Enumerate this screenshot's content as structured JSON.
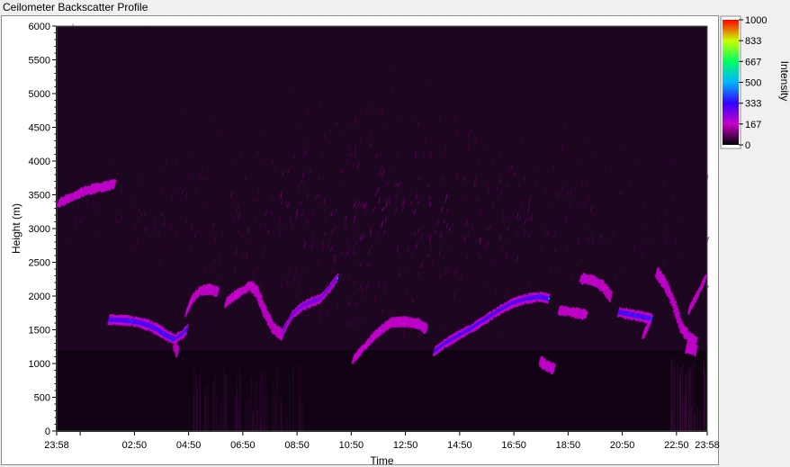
{
  "window": {
    "title": "Ceilometer Backscatter Profile"
  },
  "chart_data": {
    "type": "heatmap",
    "title": "",
    "xlabel": "Time",
    "ylabel": "Height (m)",
    "x_tick_labels": [
      "23:58",
      "02:50",
      "04:50",
      "06:50",
      "08:50",
      "10:50",
      "12:50",
      "14:50",
      "16:50",
      "18:50",
      "20:50",
      "22:50",
      "23:58"
    ],
    "x_tick_hours": [
      -0.0333,
      2.8333,
      4.8333,
      6.8333,
      8.8333,
      10.8333,
      12.8333,
      14.8333,
      16.8333,
      18.8333,
      20.8333,
      22.8333,
      23.9667
    ],
    "x_minor_tick_hours": [
      0.8333
    ],
    "xlim_hours": [
      -0.0333,
      23.9667
    ],
    "ylim": [
      0,
      6000
    ],
    "y_ticks": [
      0,
      500,
      1000,
      1500,
      2000,
      2500,
      3000,
      3500,
      4000,
      4500,
      5000,
      5500,
      6000
    ],
    "colorbar": {
      "label": "Intensity",
      "range": [
        0,
        1000
      ],
      "ticks": [
        1000,
        833,
        667,
        500,
        333,
        167,
        0
      ],
      "stops": [
        {
          "value": 0,
          "color": "#000000"
        },
        {
          "value": 167,
          "color": "#c800c8"
        },
        {
          "value": 333,
          "color": "#3200ff"
        },
        {
          "value": 500,
          "color": "#00b4ff"
        },
        {
          "value": 667,
          "color": "#00ff64"
        },
        {
          "value": 833,
          "color": "#c8ff00"
        },
        {
          "value": 1000,
          "color": "#ff0000"
        }
      ]
    },
    "background_color": "#1c0620",
    "near_ground_layer": {
      "ylim": [
        0,
        1200
      ],
      "intensity": 12
    },
    "noise": {
      "height_range": [
        1200,
        6000
      ],
      "peak_height": 3200,
      "intensity": [
        30,
        110
      ]
    },
    "layer_segments": [
      {
        "points": [
          [
            0.03,
            3380
          ],
          [
            0.5,
            3460
          ],
          [
            0.9,
            3540
          ],
          [
            1.3,
            3590
          ],
          [
            1.7,
            3620
          ],
          [
            2.1,
            3660
          ]
        ],
        "intensity": 160
      },
      {
        "points": [
          [
            1.9,
            1650
          ],
          [
            2.5,
            1640
          ],
          [
            3.0,
            1610
          ],
          [
            3.4,
            1560
          ],
          [
            3.7,
            1500
          ],
          [
            4.0,
            1420
          ],
          [
            4.3,
            1360
          ],
          [
            4.6,
            1430
          ],
          [
            4.75,
            1500
          ]
        ],
        "intensity": 290
      },
      {
        "points": [
          [
            4.3,
            1280
          ],
          [
            4.42,
            1160
          ]
        ],
        "intensity": 160
      },
      {
        "points": [
          [
            4.75,
            1760
          ],
          [
            4.95,
            1950
          ],
          [
            5.25,
            2080
          ],
          [
            5.6,
            2100
          ],
          [
            5.9,
            2060
          ]
        ],
        "intensity": 150
      },
      {
        "points": [
          [
            6.2,
            1900
          ],
          [
            6.5,
            2000
          ],
          [
            6.8,
            2070
          ],
          [
            7.1,
            2160
          ],
          [
            7.35,
            2060
          ],
          [
            7.6,
            1800
          ],
          [
            7.95,
            1520
          ],
          [
            8.3,
            1420
          ]
        ],
        "intensity": 150
      },
      {
        "points": [
          [
            8.3,
            1460
          ],
          [
            8.65,
            1720
          ],
          [
            9.0,
            1840
          ],
          [
            9.3,
            1900
          ],
          [
            9.7,
            1960
          ],
          [
            10.0,
            2100
          ],
          [
            10.3,
            2260
          ]
        ],
        "intensity": 240
      },
      {
        "points": [
          [
            10.9,
            1060
          ],
          [
            11.3,
            1240
          ],
          [
            11.7,
            1420
          ],
          [
            12.0,
            1520
          ],
          [
            12.3,
            1610
          ],
          [
            12.8,
            1620
          ],
          [
            13.3,
            1590
          ],
          [
            13.6,
            1510
          ]
        ],
        "intensity": 150
      },
      {
        "points": [
          [
            13.9,
            1180
          ],
          [
            14.3,
            1300
          ],
          [
            14.8,
            1420
          ],
          [
            15.3,
            1530
          ],
          [
            15.8,
            1660
          ],
          [
            16.3,
            1790
          ],
          [
            16.8,
            1900
          ],
          [
            17.3,
            1960
          ],
          [
            17.8,
            1990
          ],
          [
            18.1,
            1960
          ]
        ],
        "intensity": 280
      },
      {
        "points": [
          [
            17.8,
            1040
          ],
          [
            18.0,
            970
          ],
          [
            18.3,
            920
          ]
        ],
        "intensity": 180
      },
      {
        "points": [
          [
            18.5,
            1790
          ],
          [
            19.0,
            1760
          ],
          [
            19.5,
            1720
          ]
        ],
        "intensity": 170
      },
      {
        "points": [
          [
            19.3,
            2260
          ],
          [
            19.7,
            2240
          ],
          [
            20.1,
            2150
          ],
          [
            20.4,
            1990
          ]
        ],
        "intensity": 170
      },
      {
        "points": [
          [
            20.7,
            1760
          ],
          [
            21.1,
            1730
          ],
          [
            21.5,
            1700
          ],
          [
            21.9,
            1660
          ]
        ],
        "intensity": 290
      },
      {
        "points": [
          [
            21.6,
            1420
          ],
          [
            21.85,
            1600
          ]
        ],
        "intensity": 150
      },
      {
        "points": [
          [
            22.1,
            2350
          ],
          [
            22.4,
            2180
          ],
          [
            22.7,
            1920
          ],
          [
            23.0,
            1540
          ],
          [
            23.3,
            1380
          ],
          [
            23.55,
            1320
          ]
        ],
        "intensity": 150
      },
      {
        "points": [
          [
            23.2,
            1230
          ],
          [
            23.55,
            1190
          ]
        ],
        "intensity": 150
      },
      {
        "points": [
          [
            23.3,
            1800
          ],
          [
            23.6,
            2020
          ],
          [
            23.9,
            2270
          ]
        ],
        "intensity": 150
      }
    ]
  }
}
